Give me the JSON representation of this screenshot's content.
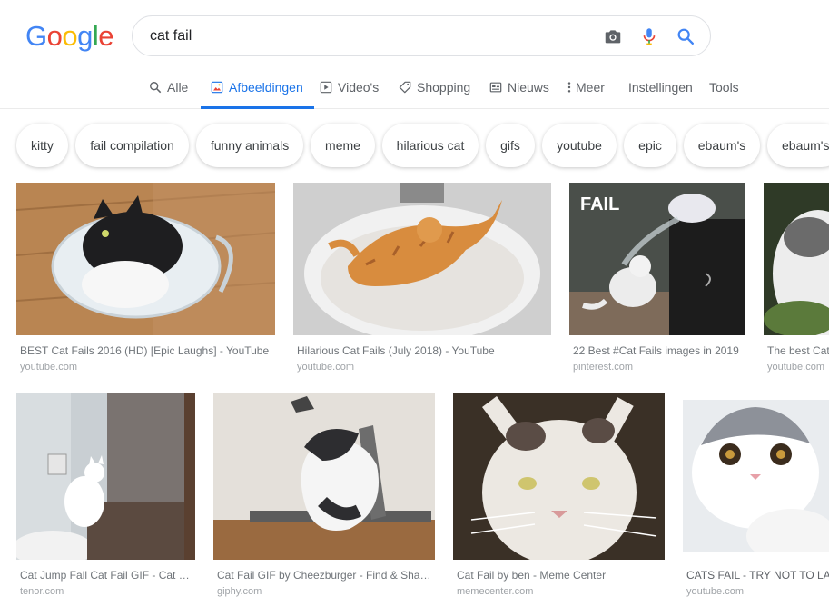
{
  "brand": {
    "logo_letters": [
      {
        "char": "G",
        "color": "#4285F4"
      },
      {
        "char": "o",
        "color": "#EA4335"
      },
      {
        "char": "o",
        "color": "#FBBC05"
      },
      {
        "char": "g",
        "color": "#4285F4"
      },
      {
        "char": "l",
        "color": "#34A853"
      },
      {
        "char": "e",
        "color": "#EA4335"
      }
    ]
  },
  "search": {
    "query": "cat fail",
    "icons": [
      "camera-icon",
      "microphone-icon",
      "search-icon"
    ]
  },
  "tabs": [
    {
      "label": "Alle",
      "icon": "search-icon",
      "active": false
    },
    {
      "label": "Afbeeldingen",
      "icon": "image-icon",
      "active": true
    },
    {
      "label": "Video's",
      "icon": "video-icon",
      "active": false
    },
    {
      "label": "Shopping",
      "icon": "tag-icon",
      "active": false
    },
    {
      "label": "Nieuws",
      "icon": "news-icon",
      "active": false
    },
    {
      "label": "Meer",
      "icon": "more-vertical-icon",
      "active": false
    },
    {
      "label": "Instellingen",
      "icon": "",
      "active": false
    },
    {
      "label": "Tools",
      "icon": "",
      "active": false
    }
  ],
  "chips": [
    "kitty",
    "fail compilation",
    "funny animals",
    "meme",
    "hilarious cat",
    "gifs",
    "youtube",
    "epic",
    "ebaum's",
    "ebaum's"
  ],
  "results": [
    {
      "title": "BEST Cat Fails 2016 (HD) [Epic Laughs] - YouTube",
      "source": "youtube.com"
    },
    {
      "title": "Hilarious Cat Fails (July 2018) - YouTube",
      "source": "youtube.com"
    },
    {
      "title": "22 Best #Cat Fails images in 2019",
      "source": "pinterest.com",
      "overlay": "FAIL"
    },
    {
      "title": "The best Cat Fails",
      "source": "youtube.com"
    },
    {
      "title": "Cat Jump Fall Cat Fail GIF - Cat Jump Fall",
      "source": "tenor.com"
    },
    {
      "title": "Cat Fail GIF by Cheezburger - Find & Share on GIPHY",
      "source": "giphy.com"
    },
    {
      "title": "Cat Fail by ben - Meme Center",
      "source": "memecenter.com"
    },
    {
      "title": "CATS FAIL - TRY NOT TO LAUGH",
      "source": "youtube.com"
    }
  ],
  "colors": {
    "accent": "#1a73e8",
    "text": "#202124",
    "muted": "#70757a"
  }
}
